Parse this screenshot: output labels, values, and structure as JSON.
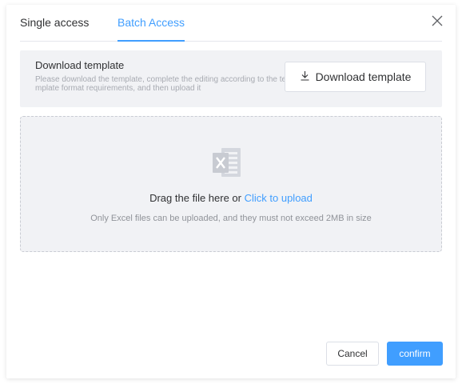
{
  "tabs": [
    {
      "label": "Single access",
      "active": false
    },
    {
      "label": "Batch Access",
      "active": true
    }
  ],
  "template": {
    "title": "Download template",
    "description": "Please download the template, complete the editing according to the template format requirements, and then upload it",
    "button_label": "Download template",
    "button_icon": "download-icon"
  },
  "upload": {
    "icon": "excel-file-icon",
    "prompt": "Drag the file here or ",
    "link": "Click to upload",
    "tip": "Only Excel files can be uploaded, and they must not exceed 2MB in size"
  },
  "footer": {
    "cancel_label": "Cancel",
    "confirm_label": "confirm"
  },
  "colors": {
    "accent": "#409eff",
    "panel_bg": "#f1f2f5",
    "text": "#303133",
    "muted": "#909399"
  }
}
